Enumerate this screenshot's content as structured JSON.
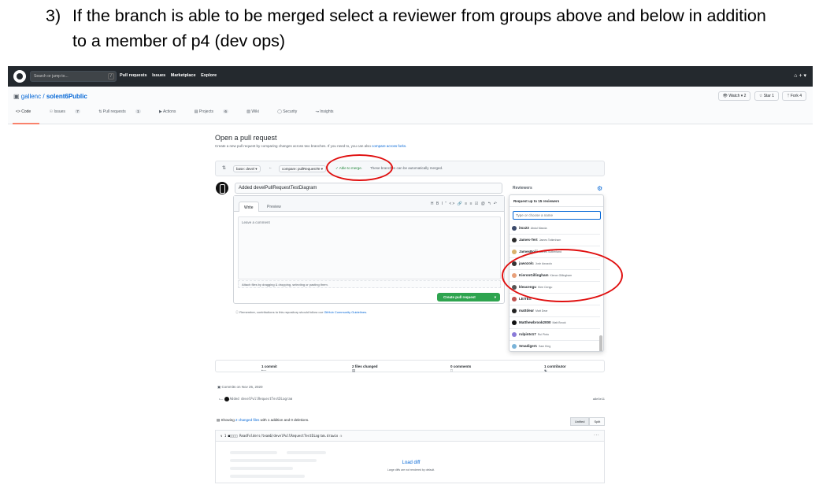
{
  "instruction": {
    "number": "3)",
    "text": "If the branch is able to be merged select a reviewer from groups above and below in addition to a member of p4 (dev ops)"
  },
  "header": {
    "search_placeholder": "Search or jump to...",
    "search_key": "/",
    "nav": [
      "Pull requests",
      "Issues",
      "Marketplace",
      "Explore"
    ],
    "right_icons": "⌂ + ▾"
  },
  "repo": {
    "owner": "gallenc",
    "separator": " / ",
    "name": "solent6Public",
    "watch_label": "Watch ▾",
    "watch_count": "2",
    "star_label": "Star",
    "star_count": "1",
    "fork_label": "Fork",
    "fork_count": "4",
    "tabs": [
      {
        "label": "Code",
        "count": ""
      },
      {
        "label": "Issues",
        "count": "7"
      },
      {
        "label": "Pull requests",
        "count": "1"
      },
      {
        "label": "Actions",
        "count": ""
      },
      {
        "label": "Projects",
        "count": "6"
      },
      {
        "label": "Wiki",
        "count": ""
      },
      {
        "label": "Security",
        "count": ""
      },
      {
        "label": "Insights",
        "count": ""
      }
    ]
  },
  "compare": {
    "title": "Open a pull request",
    "subtitle": "Create a new pull request by comparing changes across two branches. If you need to, you can also",
    "subtitle_link": "compare across forks.",
    "base": "base: devel ▾",
    "arrow": "←",
    "head": "compare: pullRequestTe ▾",
    "merge_ok": "✓ Able to merge.",
    "merge_rest": "These branches can be automatically merged."
  },
  "form": {
    "title_value": "Added develPullRequestTestDiagram",
    "tab_write": "Write",
    "tab_preview": "Preview",
    "toolbar": "H B I  “ <> 🔗  ≡ ≡ ☑  @ ↰ ↶",
    "comment_placeholder": "Leave a comment",
    "attach_hint": "Attach files by dragging & dropping, selecting or pasting them.",
    "create_button": "Create pull request",
    "create_caret": "▾",
    "remember_text": "Remember, contributions to this repository should follow our",
    "remember_link": "GitHub Community Guidelines."
  },
  "reviewers": {
    "label": "Reviewers",
    "gear_icon": "⚙",
    "dropdown_title": "Request up to 15 reviewers",
    "filter_placeholder": "Type or choose a name",
    "items": [
      {
        "login": "itsx23",
        "fullname": "Abdul Manda",
        "color": "#3b4a6b"
      },
      {
        "login": "James-Tert",
        "fullname": "James Tottenham",
        "color": "#2b2b2b"
      },
      {
        "login": "JamesBoiii",
        "fullname": "James Sutherland",
        "color": "#d9b26b"
      },
      {
        "login": "jawozolc",
        "fullname": "Josh Awozolo",
        "color": "#333333"
      },
      {
        "login": "KieronGillingham",
        "fullname": "Kieron Gillingham",
        "color": "#e8a07a"
      },
      {
        "login": "kleacengu",
        "fullname": "Klee Cengu",
        "color": "#555555"
      },
      {
        "login": "LEITES",
        "fullname": "",
        "color": "#c0504d"
      },
      {
        "login": "mattdear",
        "fullname": "Matt Dear",
        "color": "#222222"
      },
      {
        "login": "Matthewbrook2000",
        "fullname": "Matt Brook",
        "color": "#111111"
      },
      {
        "login": "rulpinto17",
        "fullname": "Rui Pinto",
        "color": "#8a7ad8"
      },
      {
        "login": "Smadiger1",
        "fullname": "Sam King",
        "color": "#7ab3d8"
      }
    ]
  },
  "stats": {
    "commits": "1 commit",
    "files": "2 files changed",
    "comments": "0 comments",
    "contributors": "1 contributor"
  },
  "commits": {
    "date_label": "Commits on Nov 25, 2020",
    "message": "Added develPullRequestTestDiagram",
    "sha": "a8e5e11"
  },
  "diff": {
    "showing_prefix": "Showing",
    "showing_link": "2 changed files",
    "showing_suffix": "with 1 addition and 0 deletions.",
    "unified": "Unified",
    "split": "Split",
    "file_path": "∨ 1 ■□□□□ ReadFolders/team6/develPullRequestTestDiagram.drawio ❐",
    "more": "···",
    "load_diff": "Load diff",
    "load_sub": "Large diffs are not rendered by default."
  }
}
